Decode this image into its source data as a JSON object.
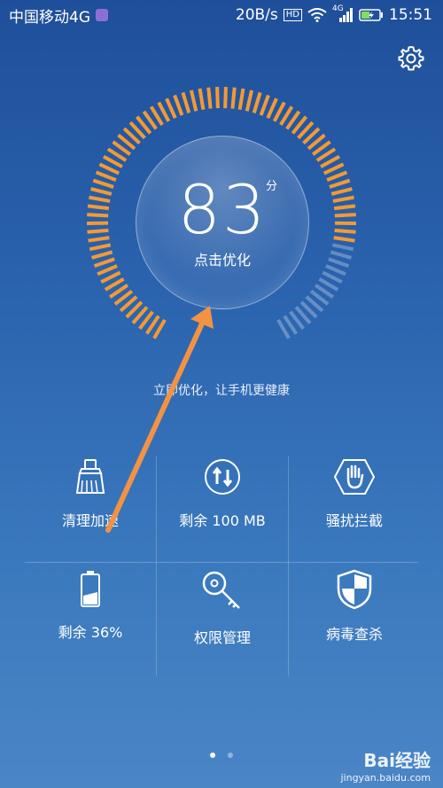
{
  "statusbar": {
    "carrier": "中国移动4G",
    "speed": "20B/s",
    "hd": "HD",
    "net": "4G",
    "time": "15:51"
  },
  "dial": {
    "score": "83",
    "unit": "分",
    "action": "点击优化",
    "level": 0.83
  },
  "tip": "立即优化，让手机更健康",
  "grid": [
    {
      "label": "清理加速",
      "icon": "broom-icon"
    },
    {
      "label": "剩余 100 MB",
      "icon": "data-arrows-icon"
    },
    {
      "label": "骚扰拦截",
      "icon": "hand-block-icon"
    },
    {
      "label": "剩余 36%",
      "icon": "battery-icon"
    },
    {
      "label": "权限管理",
      "icon": "key-icon"
    },
    {
      "label": "病毒查杀",
      "icon": "shield-icon"
    }
  ],
  "pager": {
    "total": 2,
    "active": 1
  },
  "watermark": {
    "brand": "Bai经验",
    "url": "jingyan.baidu.com"
  },
  "colors": {
    "accent": "#f39a33",
    "arrow": "#f29243"
  }
}
